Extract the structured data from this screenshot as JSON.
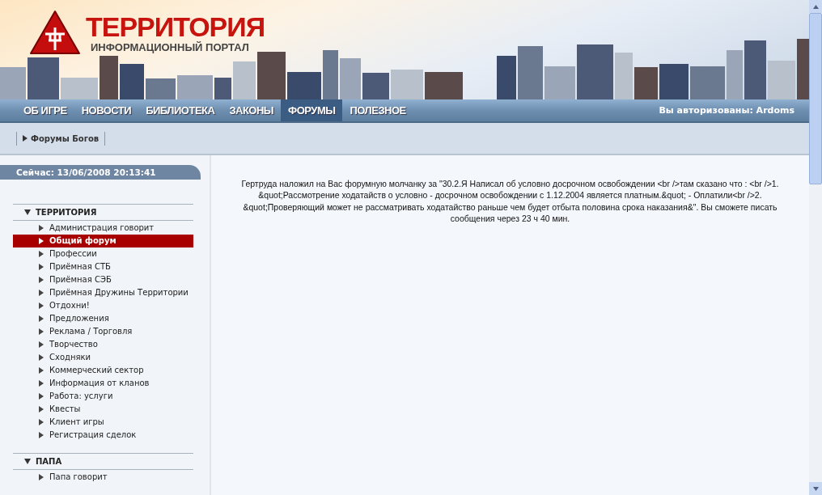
{
  "logo": {
    "title": "ТЕРРИТОРИЯ",
    "subtitle": "ИНФОРМАЦИОННЫЙ ПОРТАЛ"
  },
  "nav": [
    {
      "label": "ОБ ИГРЕ",
      "selected": false
    },
    {
      "label": "НОВОСТИ",
      "selected": false
    },
    {
      "label": "БИБЛИОТЕКА",
      "selected": false
    },
    {
      "label": "ЗАКОНЫ",
      "selected": false
    },
    {
      "label": "ФОРУМЫ",
      "selected": true
    },
    {
      "label": "ПОЛЕЗНОЕ",
      "selected": false
    }
  ],
  "auth_status": "Вы авторизованы: Ardoms",
  "breadcrumb": "Форумы Богов",
  "clock": "Сейчас: 13/06/2008 20:13:41",
  "sections": [
    {
      "title": "ТЕРРИТОРИЯ",
      "items": [
        {
          "label": "Администрация говорит",
          "selected": false
        },
        {
          "label": "Общий форум",
          "selected": true
        },
        {
          "label": "Профессии",
          "selected": false
        },
        {
          "label": "Приёмная СТБ",
          "selected": false
        },
        {
          "label": "Приёмная СЭБ",
          "selected": false
        },
        {
          "label": "Приёмная Дружины Территории",
          "selected": false
        },
        {
          "label": "Отдохни!",
          "selected": false
        },
        {
          "label": "Предложения",
          "selected": false
        },
        {
          "label": "Реклама / Торговля",
          "selected": false
        },
        {
          "label": "Творчество",
          "selected": false
        },
        {
          "label": "Сходняки",
          "selected": false
        },
        {
          "label": "Коммерческий сектор",
          "selected": false
        },
        {
          "label": "Информация от кланов",
          "selected": false
        },
        {
          "label": "Работа: услуги",
          "selected": false
        },
        {
          "label": "Квесты",
          "selected": false
        },
        {
          "label": "Клиент игры",
          "selected": false
        },
        {
          "label": "Регистрация сделок",
          "selected": false
        }
      ]
    },
    {
      "title": "ПАПА",
      "items": [
        {
          "label": "Папа говорит",
          "selected": false
        }
      ]
    }
  ],
  "message": "Гертруда наложил на Вас форумную молчанку за \"30.2.Я Написал об условно досрочном освобождении <br />там сказано что : <br />1. &quot;Рассмотрение ходатайств о условно - досрочном освобождении с 1.12.2004 является платным.&quot; - Оплатили<br />2. &quot;Проверяющий может не рассматривать ходатайство раньше чем будет отбыта половина срока наказания&\". Вы сможете писать сообщения через 23 ч 40 мин."
}
